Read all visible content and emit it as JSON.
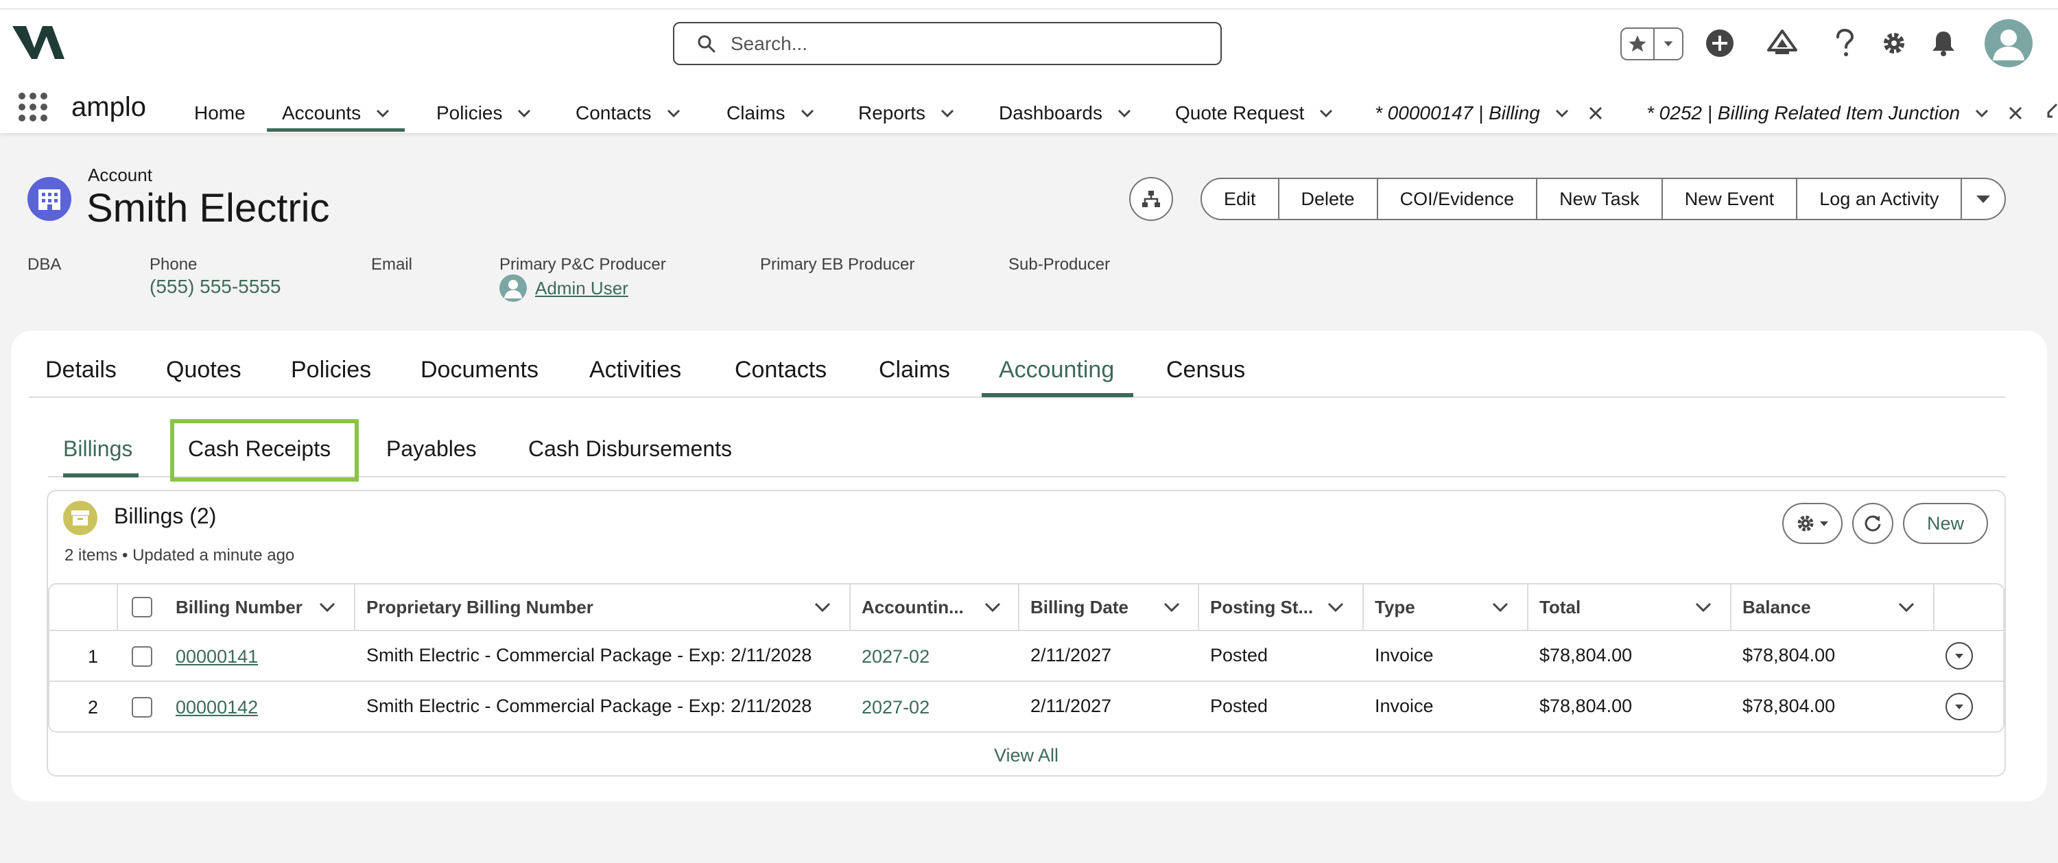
{
  "header": {
    "search_placeholder": "Search...",
    "icons": [
      "search-icon",
      "star-icon",
      "chevron-down-icon",
      "plus-icon",
      "trailhead-icon",
      "help-icon",
      "gear-icon",
      "bell-icon",
      "avatar-icon"
    ]
  },
  "nav": {
    "app_name": "amplo",
    "items": [
      {
        "label": "Home"
      },
      {
        "label": "Accounts"
      },
      {
        "label": "Policies"
      },
      {
        "label": "Contacts"
      },
      {
        "label": "Claims"
      },
      {
        "label": "Reports"
      },
      {
        "label": "Dashboards"
      },
      {
        "label": "Quote Request"
      },
      {
        "label": "* 00000147 | Billing"
      },
      {
        "label": "* 0252 | Billing Related Item Junction"
      }
    ]
  },
  "record": {
    "type": "Account",
    "title": "Smith Electric",
    "actions": [
      "Edit",
      "Delete",
      "COI/Evidence",
      "New Task",
      "New Event",
      "Log an Activity"
    ],
    "highlights": {
      "dba_label": "DBA",
      "phone_label": "Phone",
      "phone_value": "(555) 555-5555",
      "email_label": "Email",
      "primary_pc_label": "Primary P&C Producer",
      "primary_pc_value": "Admin User",
      "primary_eb_label": "Primary EB Producer",
      "sub_producer_label": "Sub-Producer"
    }
  },
  "tabs": [
    "Details",
    "Quotes",
    "Policies",
    "Documents",
    "Activities",
    "Contacts",
    "Claims",
    "Accounting",
    "Census"
  ],
  "subtabs": [
    "Billings",
    "Cash Receipts",
    "Payables",
    "Cash Disbursements"
  ],
  "related_list": {
    "title": "Billings (2)",
    "subtitle": "2 items • Updated a minute ago",
    "new_label": "New",
    "view_all": "View All",
    "columns": [
      "Billing Number",
      "Proprietary Billing Number",
      "Accountin...",
      "Billing Date",
      "Posting St...",
      "Type",
      "Total",
      "Balance"
    ],
    "rows": [
      {
        "num": "1",
        "billing_number": "00000141",
        "proprietary": "Smith Electric - Commercial Package - Exp: 2/11/2028",
        "accounting": "2027-02",
        "billing_date": "2/11/2027",
        "posting": "Posted",
        "type": "Invoice",
        "total": "$78,804.00",
        "balance": "$78,804.00"
      },
      {
        "num": "2",
        "billing_number": "00000142",
        "proprietary": "Smith Electric - Commercial Package - Exp: 2/11/2028",
        "accounting": "2027-02",
        "billing_date": "2/11/2027",
        "posting": "Posted",
        "type": "Invoice",
        "total": "$78,804.00",
        "balance": "$78,804.00"
      }
    ]
  },
  "colors": {
    "accent": "#3d6a58",
    "highlight_box": "#8bc34a",
    "account_icon": "#5a63d8",
    "billing_icon": "#cbc35d"
  }
}
